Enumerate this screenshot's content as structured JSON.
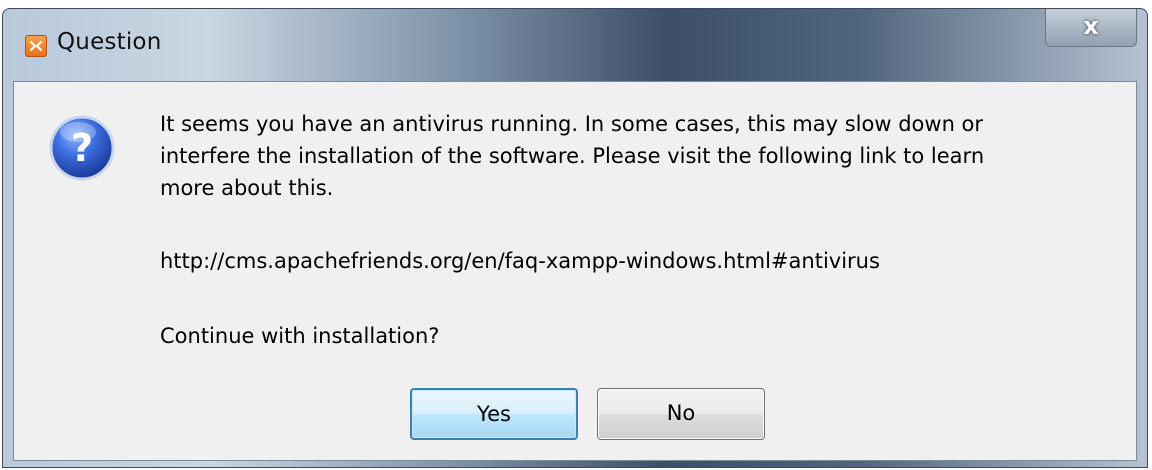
{
  "window": {
    "title": "Question",
    "close_label": "x"
  },
  "message": {
    "line1": "It seems you have an antivirus running. In some cases, this may slow down or",
    "line2": "interfere the installation of the software. Please visit the following link to learn",
    "line3": "more about this.",
    "link": "http://cms.apachefriends.org/en/faq-xampp-windows.html#antivirus",
    "prompt": "Continue with installation?"
  },
  "buttons": {
    "yes_label": "Yes",
    "no_label": "No"
  },
  "icons": {
    "app": "xampp-icon",
    "message": "question-icon"
  },
  "colors": {
    "dialog_background": "#f0f0f0",
    "default_button_border": "#3c7fb1",
    "app_icon": "#e8721a",
    "question_icon": "#2a5bc8"
  }
}
